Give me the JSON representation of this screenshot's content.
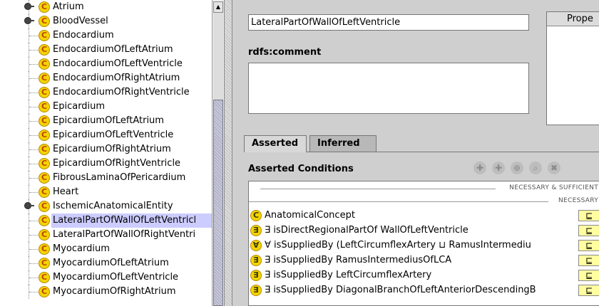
{
  "tree": {
    "items": [
      {
        "label": "Atrium",
        "expandable": true,
        "selected": false
      },
      {
        "label": "BloodVessel",
        "expandable": true,
        "selected": false
      },
      {
        "label": "Endocardium",
        "expandable": false,
        "selected": false
      },
      {
        "label": "EndocardiumOfLeftAtrium",
        "expandable": false,
        "selected": false
      },
      {
        "label": "EndocardiumOfLeftVentricle",
        "expandable": false,
        "selected": false
      },
      {
        "label": "EndocardiumOfRightAtrium",
        "expandable": false,
        "selected": false
      },
      {
        "label": "EndocardiumOfRightVentricle",
        "expandable": false,
        "selected": false
      },
      {
        "label": "Epicardium",
        "expandable": false,
        "selected": false
      },
      {
        "label": "EpicardiumOfLeftAtrium",
        "expandable": false,
        "selected": false
      },
      {
        "label": "EpicardiumOfLeftVentricle",
        "expandable": false,
        "selected": false
      },
      {
        "label": "EpicardiumOfRightAtrium",
        "expandable": false,
        "selected": false
      },
      {
        "label": "EpicardiumOfRightVentricle",
        "expandable": false,
        "selected": false
      },
      {
        "label": "FibrousLaminaOfPericardium",
        "expandable": false,
        "selected": false
      },
      {
        "label": "Heart",
        "expandable": false,
        "selected": false
      },
      {
        "label": "IschemicAnatomicalEntity",
        "expandable": true,
        "selected": false
      },
      {
        "label": "LateralPartOfWallOfLeftVentricl",
        "expandable": false,
        "selected": true
      },
      {
        "label": "LateralPartOfWallOfRightVentri",
        "expandable": false,
        "selected": false
      },
      {
        "label": "Myocardium",
        "expandable": false,
        "selected": false
      },
      {
        "label": "MyocardiumOfLeftAtrium",
        "expandable": false,
        "selected": false
      },
      {
        "label": "MyocardiumOfLeftVentricle",
        "expandable": false,
        "selected": false
      },
      {
        "label": "MyocardiumOfRightAtrium",
        "expandable": false,
        "selected": false
      }
    ],
    "class_icon_glyph": "C"
  },
  "class_editor": {
    "name_value": "LateralPartOfWallOfLeftVentricle",
    "comment_label": "rdfs:comment",
    "comment_value": "",
    "properties_header": "Prope"
  },
  "tabs": [
    {
      "label": "Asserted",
      "active": true
    },
    {
      "label": "Inferred",
      "active": false
    }
  ],
  "conditions": {
    "title": "Asserted Conditions",
    "tools": [
      "add-named-class-icon",
      "add-restriction-icon",
      "add-superclass-icon",
      "search-icon",
      "delete-icon"
    ],
    "sections": [
      "NECESSARY & SUFFICIENT",
      "NECESSARY"
    ],
    "rows": [
      {
        "icon": "C",
        "text": "AnatomicalConcept",
        "symbol": "⊑"
      },
      {
        "icon": "∃",
        "text": "∃ isDirectRegionalPartOf WallOfLeftVentricle",
        "symbol": "⊑"
      },
      {
        "icon": "∀",
        "text": "∀ isSuppliedBy (LeftCircumflexArtery ⊔ RamusIntermediu",
        "symbol": "⊑"
      },
      {
        "icon": "∃",
        "text": "∃ isSuppliedBy RamusIntermediusOfLCA",
        "symbol": "⊑"
      },
      {
        "icon": "∃",
        "text": "∃ isSuppliedBy LeftCircumflexArtery",
        "symbol": "⊑"
      },
      {
        "icon": "∃",
        "text": "∃ isSuppliedBy DiagonalBranchOfLeftAnteriorDescendingB",
        "symbol": "⊑"
      }
    ]
  }
}
